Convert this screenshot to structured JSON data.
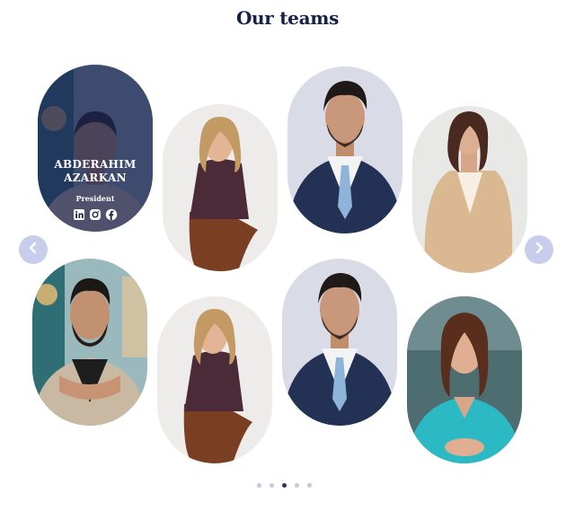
{
  "section": {
    "title": "Our teams"
  },
  "featured": {
    "name": "ABDERAHIM AZARKAN",
    "role": "President",
    "social": [
      "linkedin-icon",
      "instagram-icon",
      "facebook-icon"
    ]
  },
  "carousel": {
    "prev_icon": "chevron-left-icon",
    "next_icon": "chevron-right-icon",
    "pages": 5,
    "active_page": 3
  },
  "colors": {
    "title": "#17204a",
    "overlay": "#1c2452",
    "arrow_bg": "#c7cdea",
    "dot_active": "#2d3768",
    "dot_inactive": "#c5c9dc"
  }
}
